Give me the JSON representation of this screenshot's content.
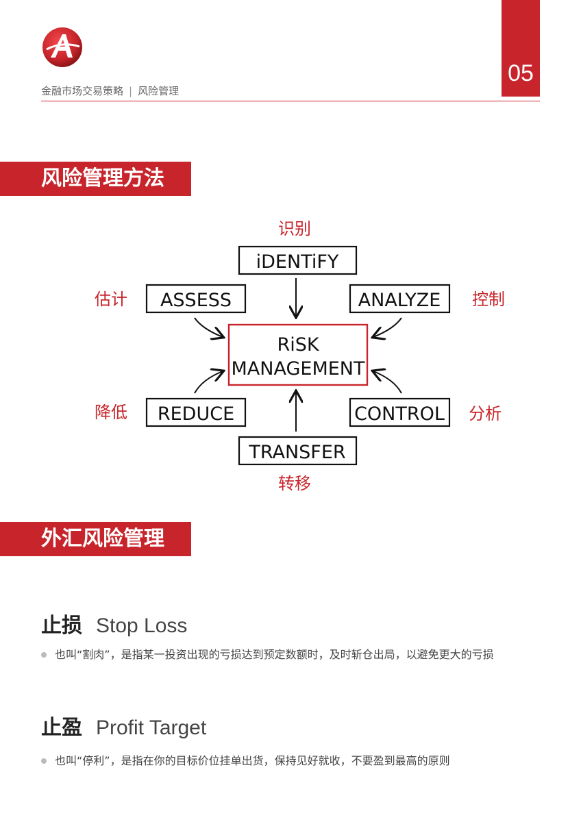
{
  "header": {
    "breadcrumb_title": "金融市场交易策略",
    "breadcrumb_sep": "|",
    "breadcrumb_section": "风险管理",
    "page_number": "05"
  },
  "colors": {
    "accent": "#c7252b"
  },
  "sections": [
    {
      "title": "风险管理方法"
    },
    {
      "title": "外汇风险管理"
    }
  ],
  "diagram": {
    "center": [
      "RiSK",
      "MANAGEMENT"
    ],
    "nodes": {
      "identify": {
        "en": "iDENTiFY",
        "zh": "识别"
      },
      "assess": {
        "en": "ASSESS",
        "zh": "估计"
      },
      "analyze": {
        "en": "ANALYZE",
        "zh": "控制"
      },
      "reduce": {
        "en": "REDUCE",
        "zh": "降低"
      },
      "control": {
        "en": "CONTROL",
        "zh": "分析"
      },
      "transfer": {
        "en": "TRANSFER",
        "zh": "转移"
      }
    }
  },
  "items": [
    {
      "title_zh": "止损",
      "title_en": "Stop Loss",
      "text": "也叫“割肉”，是指某一投资出现的亏损达到预定数额时，及时斩仓出局，以避免更大的亏损"
    },
    {
      "title_zh": "止盈",
      "title_en": "Profit Target",
      "text": "也叫“停利”，是指在你的目标价位挂单出货，保持见好就收，不要盈到最高的原则"
    }
  ]
}
